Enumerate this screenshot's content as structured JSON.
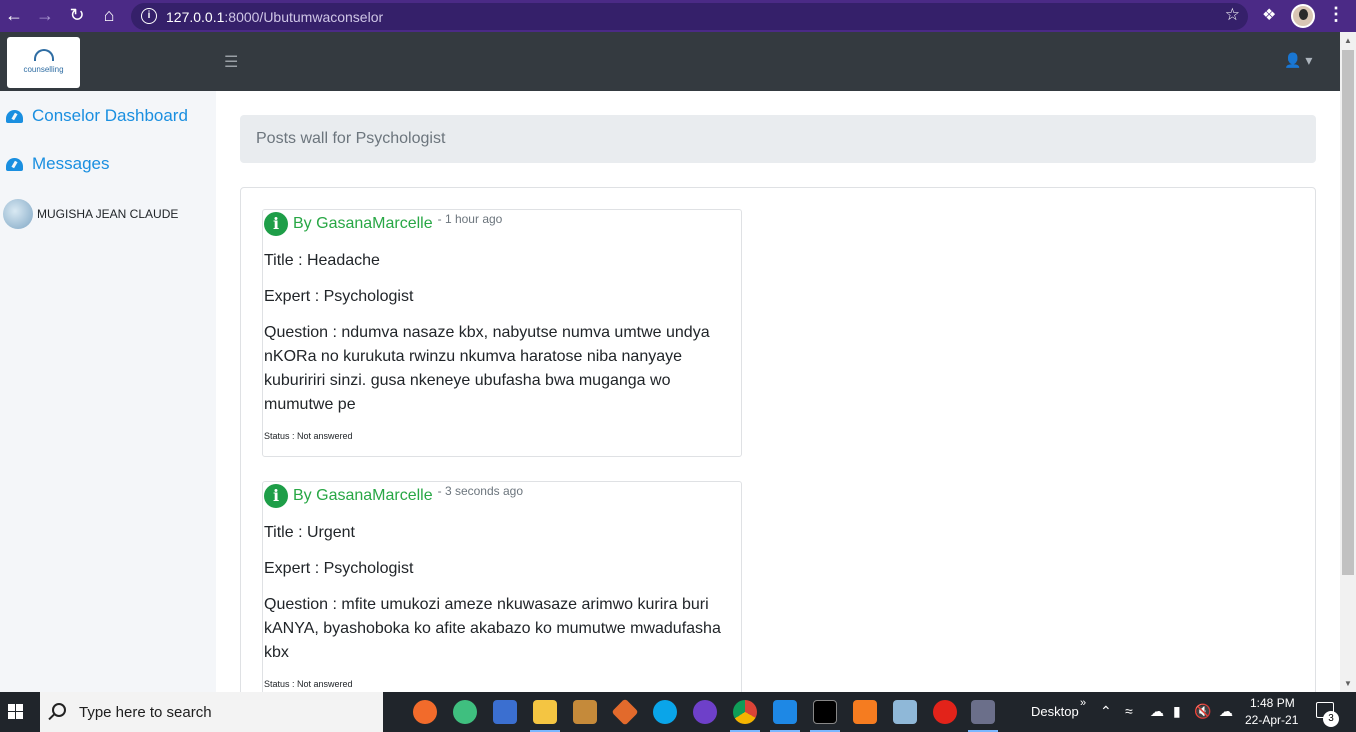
{
  "browser": {
    "url_host": "127.0.0.1",
    "url_rest": ":8000/Ubutumwaconselor"
  },
  "navbar": {
    "logo_text": "counselling"
  },
  "sidebar": {
    "items": [
      {
        "label": "Conselor Dashboard"
      },
      {
        "label": "Messages"
      }
    ],
    "user_name": "MUGISHA JEAN CLAUDE"
  },
  "main": {
    "header_title": "Posts wall for Psychologist",
    "posts": [
      {
        "author": "By GasanaMarcelle",
        "time": "- 1 hour ago",
        "title": "Title : Headache",
        "expert": "Expert : Psychologist",
        "question": "Question : ndumva nasaze kbx, nabyutse numva umtwe undya nKORa no kurukuta rwinzu nkumva haratose niba nanyaye kubuririri sinzi. gusa nkeneye ubufasha bwa muganga wo mumutwe pe",
        "status": "Status : Not answered"
      },
      {
        "author": "By GasanaMarcelle",
        "time": "- 3 seconds ago",
        "title": "Title : Urgent",
        "expert": "Expert : Psychologist",
        "question": "Question : mfite umukozi ameze nkuwasaze arimwo kurira buri kANYA, byashoboka ko afite akabazo ko mumutwe mwadufasha kbx",
        "status": "Status : Not answered"
      }
    ]
  },
  "taskbar": {
    "search_placeholder": "Type here to search",
    "desktop_label": "Desktop",
    "time": "1:48 PM",
    "date": "22-Apr-21",
    "notification_count": "3"
  },
  "colors": {
    "browser_frame": "#4b2a86",
    "navbar": "#343a40",
    "link": "#1a8fe0",
    "author_green": "#28a745"
  }
}
